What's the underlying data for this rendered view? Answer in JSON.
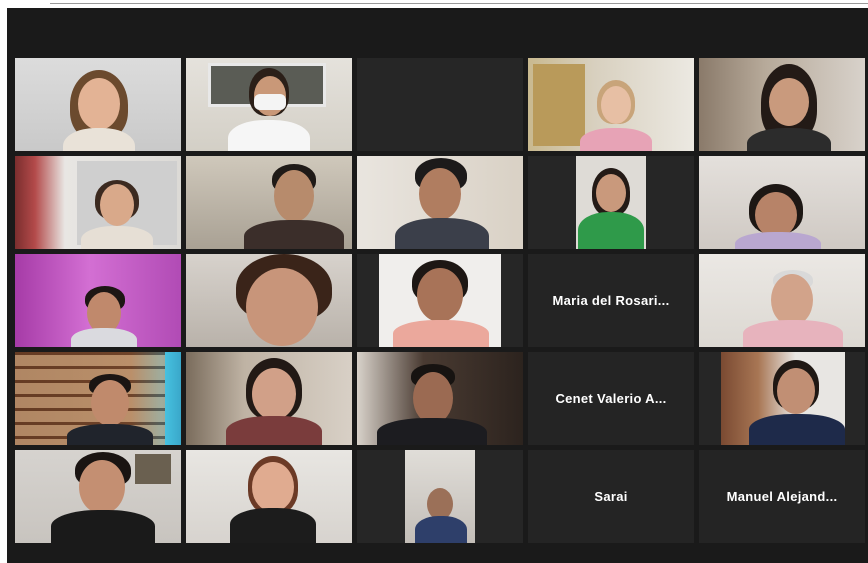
{
  "meeting": {
    "participants_without_video": [
      {
        "name": "Maria del Rosari..."
      },
      {
        "name": "Cenet Valerio A..."
      },
      {
        "name": "Sarai"
      },
      {
        "name": "Manuel Alejand..."
      }
    ],
    "active_speaker_highlight_color": "#e6e03a",
    "background_color": "#1a1a1a",
    "tile_color": "#242424"
  }
}
